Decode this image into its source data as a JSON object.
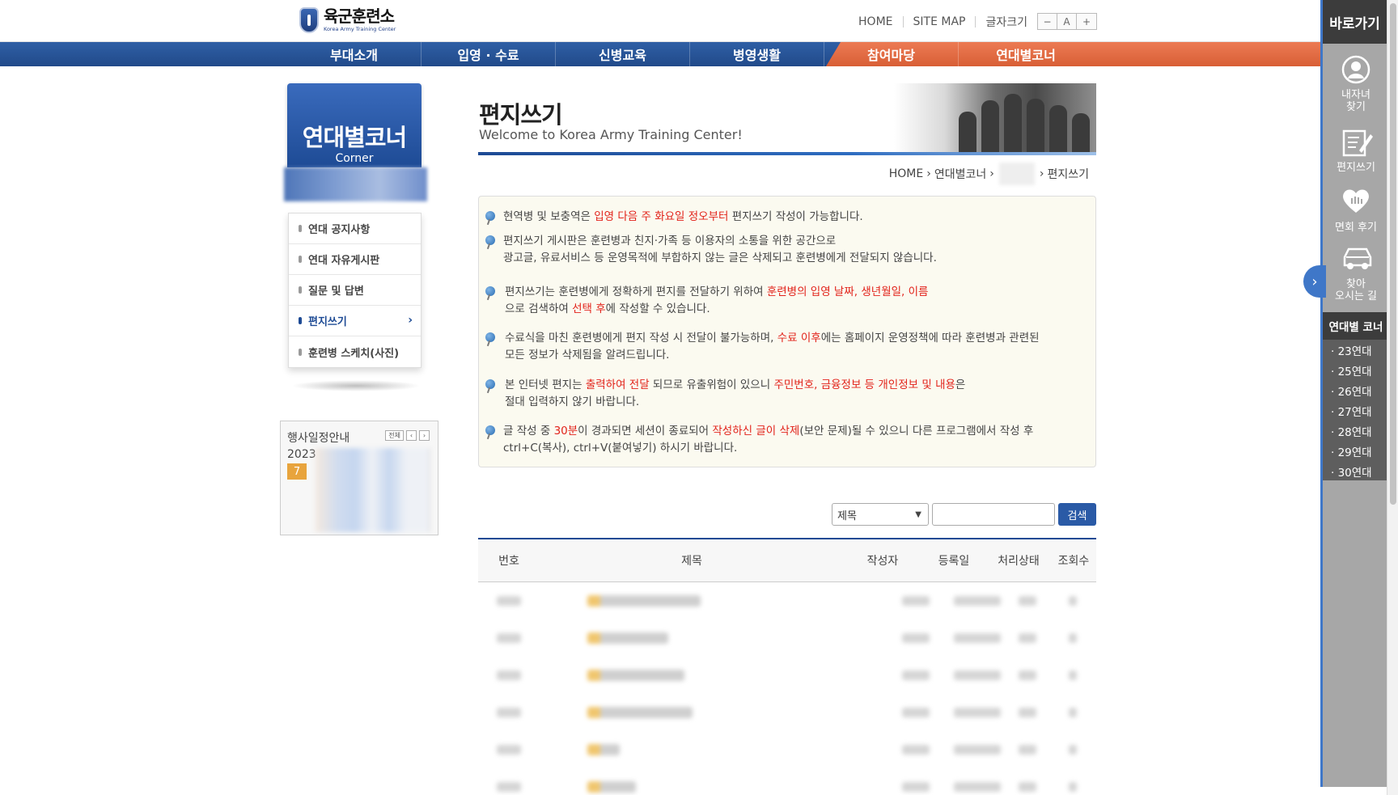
{
  "header": {
    "logo_ko": "육군훈련소",
    "logo_en": "Korea Army Training Center",
    "util_links": [
      "HOME",
      "SITE MAP",
      "글자크기"
    ],
    "font_buttons": [
      "−",
      "A",
      "+"
    ]
  },
  "nav": {
    "items": [
      "부대소개",
      "입영 · 수료",
      "신병교육",
      "병영생활",
      "참여마당",
      "연대별코너"
    ]
  },
  "sidebar": {
    "title": "연대별코너",
    "subtitle": "Corner",
    "menu": [
      {
        "label": "연대 공지사항"
      },
      {
        "label": "연대 자유게시판"
      },
      {
        "label": "질문 및 답변"
      },
      {
        "label": "편지쓰기",
        "active": true
      },
      {
        "label": "훈련병 스케치(사진)"
      }
    ],
    "calendar": {
      "title": "행사일정안내",
      "btn_all": "전체",
      "year": "2023",
      "month": "7"
    }
  },
  "main": {
    "title": "편지쓰기",
    "subtitle": "Welcome to Korea Army Training Center!",
    "breadcrumb": [
      "HOME",
      "연대별코너",
      "편지쓰기"
    ],
    "notices": [
      {
        "l1": [
          {
            "t": "현역병 및 보충역은 "
          },
          {
            "t": "입영 다음 주 화요일 정오부터",
            "red": true
          },
          {
            "t": " 편지쓰기 작성이 가능합니다."
          }
        ]
      },
      {
        "l1": [
          {
            "t": "편지쓰기 게시판은 훈련병과 친지·가족 등 이용자의 소통을 위한 공간으로"
          }
        ],
        "l2": [
          {
            "t": "광고글, 유료서비스 등 운영목적에 부합하지 않는 글은 삭제되고 훈련병에게 전달되지 않습니다."
          }
        ]
      },
      {
        "l1": [
          {
            "t": "편지쓰기는 훈련병에게 정확하게 편지를 전달하기 위하여 "
          },
          {
            "t": "훈련병의 입영 날짜, 생년월일, 이름",
            "red": true
          }
        ],
        "l2": [
          {
            "t": "으로 검색하여  "
          },
          {
            "t": "선택 후",
            "red": true
          },
          {
            "t": "에 작성할 수 있습니다."
          }
        ]
      },
      {
        "l1": [
          {
            "t": "수료식을 마친 훈련병에게 편지 작성 시 전달이 불가능하며, "
          },
          {
            "t": "수료 이후",
            "red": true
          },
          {
            "t": "에는 홈페이지 운영정책에 따라 훈련병과 관련된"
          }
        ],
        "l2": [
          {
            "t": "모든 정보가 삭제됨을 알려드립니다."
          }
        ]
      },
      {
        "l1": [
          {
            "t": "본 인터넷 편지는 "
          },
          {
            "t": "출력하여 전달",
            "red": true
          },
          {
            "t": " 되므로 유출위험이 있으니 "
          },
          {
            "t": "주민번호, 금융정보 등 개인정보 및 내용",
            "red": true
          },
          {
            "t": "은"
          }
        ],
        "l2": [
          {
            "t": "절대 입력하지 않기 바랍니다."
          }
        ]
      },
      {
        "l1": [
          {
            "t": "글 작성 중 "
          },
          {
            "t": "30분",
            "red": true
          },
          {
            "t": "이 경과되면 세션이 종료되어 "
          },
          {
            "t": "작성하신 글이 삭제",
            "red": true
          },
          {
            "t": "(보안 문제)될 수 있으니 다른 프로그램에서 작성 후"
          }
        ],
        "l2": [
          {
            "t": "ctrl+C(복사), ctrl+V(붙여넣기) 하시기 바랍니다."
          }
        ]
      }
    ],
    "search": {
      "select_value": "제목",
      "input_value": "",
      "button_label": "검색"
    },
    "table": {
      "headers": [
        "번호",
        "제목",
        "작성자",
        "등록일",
        "처리상태",
        "조회수"
      ]
    }
  },
  "quick_panel": {
    "title": "바로가기",
    "items": [
      {
        "label": "내자녀\n찾기",
        "icon": "person-icon"
      },
      {
        "label": "편지쓰기",
        "icon": "letter-edit-icon"
      },
      {
        "label": "면회 후기",
        "icon": "heart-icon"
      },
      {
        "label": "찾아\n오시는 길",
        "icon": "car-icon"
      }
    ],
    "sub_title": "연대별 코너",
    "regiments": [
      "· 23연대",
      "· 25연대",
      "· 26연대",
      "· 27연대",
      "· 28연대",
      "· 29연대",
      "· 30연대"
    ]
  },
  "colors": {
    "nav_blue": "#2f5fa5",
    "nav_orange": "#e2693f",
    "highlight_red": "#e2231a",
    "panel_gray": "#a7a7a7",
    "search_button": "#2a5aa6"
  }
}
